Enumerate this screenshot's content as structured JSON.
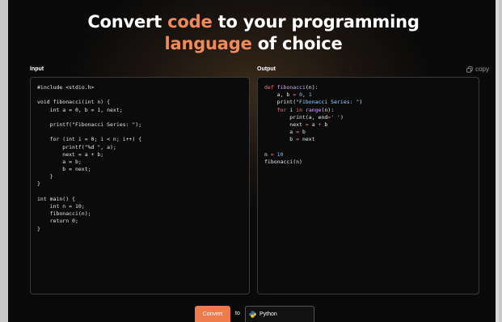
{
  "header": {
    "line1_a": "Convert ",
    "line1_accent": "code",
    "line1_b": " to your programming",
    "line2_accent": "language",
    "line2_b": " of choice"
  },
  "input_panel": {
    "label": "Input",
    "code": [
      "#include <stdio.h>",
      "",
      "void fibonacci(int n) {",
      "    int a = 0, b = 1, next;",
      "",
      "    printf(\"Fibonacci Series: \");",
      "",
      "    for (int i = 0; i < n; i++) {",
      "        printf(\"%d \", a);",
      "        next = a + b;",
      "        a = b;",
      "        b = next;",
      "    }",
      "}",
      "",
      "int main() {",
      "    int n = 10;",
      "    fibonacci(n);",
      "    return 0;",
      "}"
    ]
  },
  "output_panel": {
    "label": "Output",
    "copy_label": "copy",
    "code": [
      [
        [
          "kw",
          "def "
        ],
        [
          "fn",
          "fibonacci"
        ],
        [
          "plain",
          "(n):"
        ]
      ],
      [
        [
          "plain",
          "    a, b "
        ],
        [
          "op",
          "="
        ],
        [
          "plain",
          " "
        ],
        [
          "num",
          "0"
        ],
        [
          "plain",
          ", "
        ],
        [
          "num",
          "1"
        ]
      ],
      [
        [
          "plain",
          "    print("
        ],
        [
          "str",
          "\"Fibonacci Series: \""
        ],
        [
          "plain",
          ")"
        ]
      ],
      [
        [
          "plain",
          "    "
        ],
        [
          "kw",
          "for"
        ],
        [
          "plain",
          " i "
        ],
        [
          "kw",
          "in"
        ],
        [
          "plain",
          " "
        ],
        [
          "fn",
          "range"
        ],
        [
          "plain",
          "(n):"
        ]
      ],
      [
        [
          "plain",
          "        print(a, end"
        ],
        [
          "op",
          "="
        ],
        [
          "str",
          "' '"
        ],
        [
          "plain",
          ")"
        ]
      ],
      [
        [
          "plain",
          "        next "
        ],
        [
          "op",
          "="
        ],
        [
          "plain",
          " a "
        ],
        [
          "op",
          "+"
        ],
        [
          "plain",
          " b"
        ]
      ],
      [
        [
          "plain",
          "        a "
        ],
        [
          "op",
          "="
        ],
        [
          "plain",
          " b"
        ]
      ],
      [
        [
          "plain",
          "        b "
        ],
        [
          "op",
          "="
        ],
        [
          "plain",
          " next"
        ]
      ],
      [],
      [
        [
          "plain",
          "n "
        ],
        [
          "op",
          "="
        ],
        [
          "plain",
          " "
        ],
        [
          "num",
          "10"
        ]
      ],
      [
        [
          "plain",
          "fibonacci(n)"
        ]
      ]
    ]
  },
  "controls": {
    "convert_label": "Convert",
    "to_label": "to",
    "language_value": "Python"
  },
  "colors": {
    "accent": "#f08a5d",
    "button": "#ef7a4c"
  }
}
